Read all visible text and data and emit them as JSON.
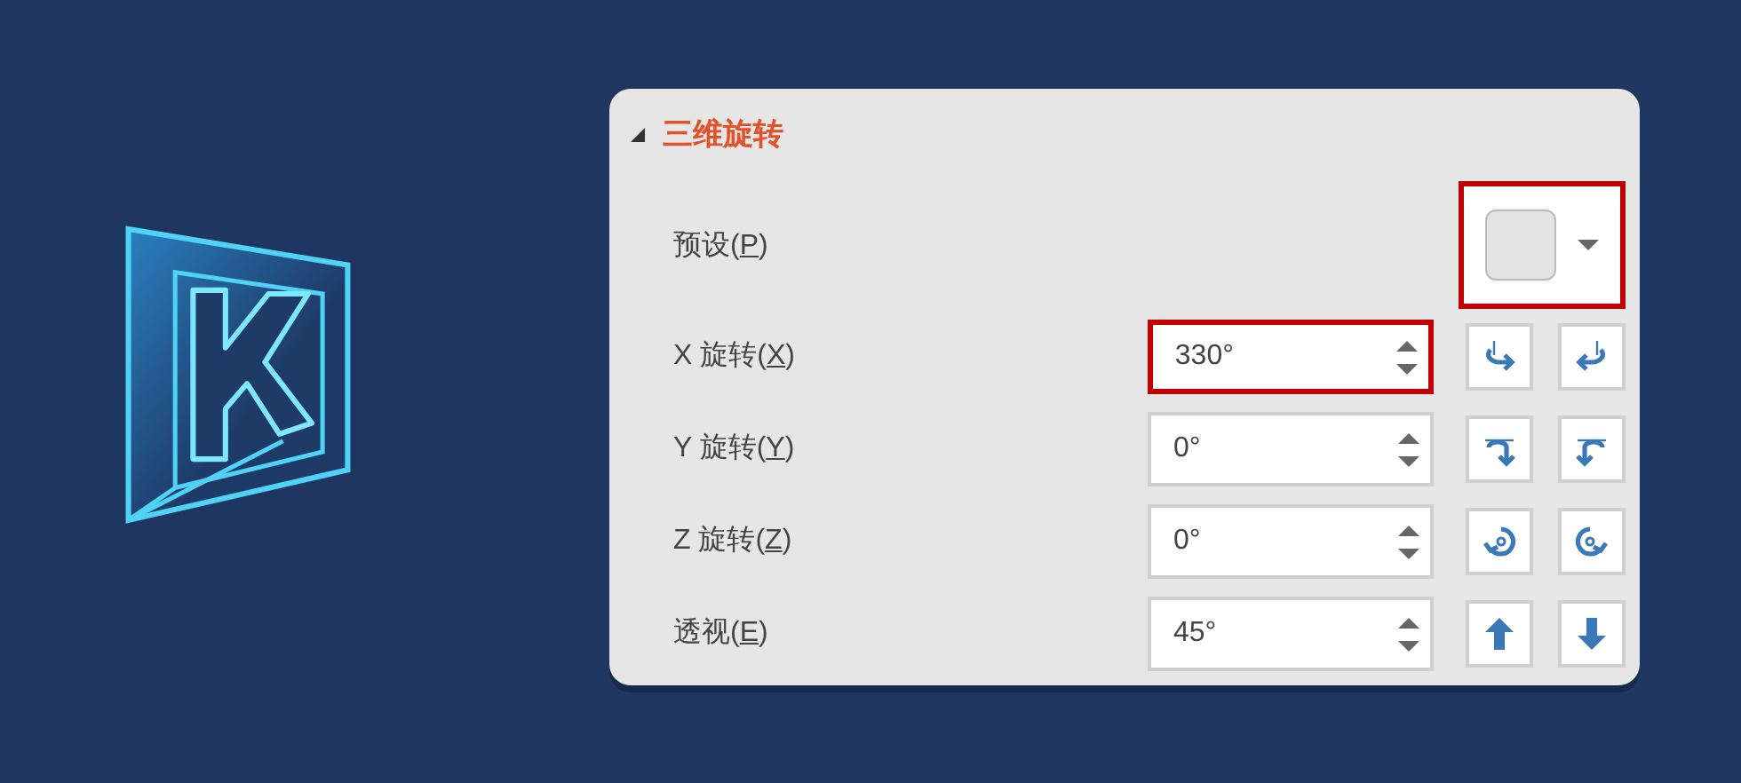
{
  "panel": {
    "section": {
      "title": "三维旋转",
      "expanded": true
    },
    "preset": {
      "label_before": "预设(",
      "hotkey": "P",
      "label_after": ")",
      "highlighted": true
    },
    "rows": [
      {
        "label_before": "X 旋转(",
        "hotkey": "X",
        "label_after": ")",
        "value": "330°",
        "highlighted": true
      },
      {
        "label_before": "Y 旋转(",
        "hotkey": "Y",
        "label_after": ")",
        "value": "0°",
        "highlighted": false
      },
      {
        "label_before": "Z 旋转(",
        "hotkey": "Z",
        "label_after": ")",
        "value": "0°",
        "highlighted": false
      },
      {
        "label_before": "透视(",
        "hotkey": "E",
        "label_after": ")",
        "value": "45°",
        "highlighted": false
      }
    ]
  }
}
